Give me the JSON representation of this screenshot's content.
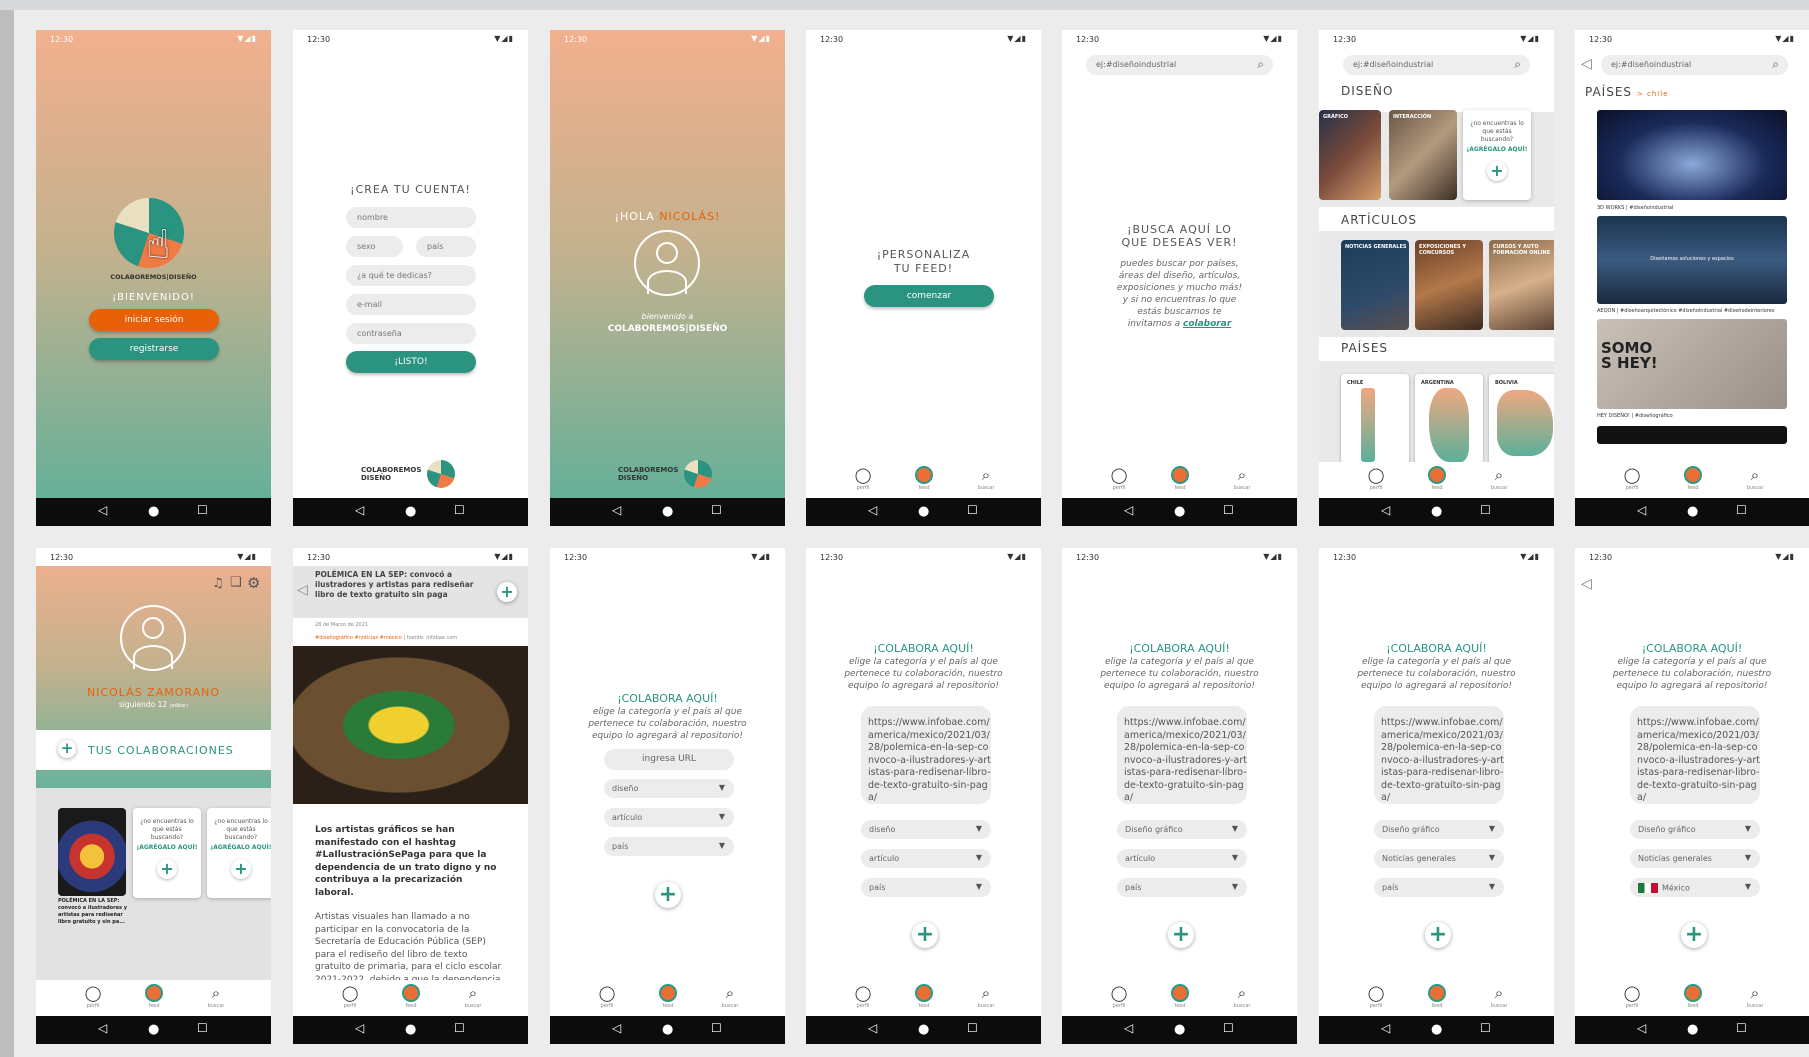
{
  "status": {
    "time": "12:30",
    "icons": "▼◢▮"
  },
  "sysnav": {
    "back": "◁",
    "home": "●",
    "recent": "☐"
  },
  "appnav": {
    "perfil": "perfil",
    "feed": "feed",
    "buscar": "buscar"
  },
  "s1": {
    "logo_text": "COLABOREMOS|DISEÑO",
    "welcome": "¡BIENVENIDO!",
    "login": "iniciar sesión",
    "register": "registrarse"
  },
  "s2": {
    "title": "¡CREA TU CUENTA!",
    "nombre": "nombre",
    "sexo": "sexo",
    "pais": "país",
    "dedicas": "¿a qué te dedicas?",
    "email": "e-mail",
    "password": "contraseña",
    "submit": "¡LISTO!",
    "logo_text": "COLABOREMOS DISEÑO"
  },
  "s3": {
    "hola": "¡HOLA ",
    "name": "NICOLÁS!",
    "bienvenido": "bienvenido a",
    "brand": "COLABOREMOS|DISEÑO",
    "logo_text": "COLABOREMOS DISEÑO"
  },
  "s4": {
    "title1": "¡PERSONALIZA",
    "title2": "TU FEED!",
    "start": "comenzar"
  },
  "s5": {
    "search_placeholder": "ej:#diseñoindustrial",
    "title1": "¡BUSCA AQUÍ LO",
    "title2": "QUE DESEAS VER!",
    "desc1": "puedes buscar por países,",
    "desc2": "áreas del diseño, artículos,",
    "desc3": "exposiciones y mucho más!",
    "desc4": "y si no encuentras lo que",
    "desc5": "estás buscamos te",
    "desc6": "invitamos a ",
    "link": "colaborar"
  },
  "s6": {
    "search_placeholder": "ej:#diseñoindustrial",
    "sec_diseno": "DISEÑO",
    "tile_grafico": "GRÁFICO",
    "tile_interaccion": "INTERACCIÓN",
    "card_q": "¿no encuentras lo que estás buscando?",
    "card_a": "¡AGRÉGALO AQUÍ!",
    "sec_articulos": "ARTÍCULOS",
    "art1": "NOTICIAS GENERALES",
    "art2": "EXPOSICIONES Y CONCURSOS",
    "art3": "CURSOS Y AUTO FORMACIÓN ONLINE",
    "sec_paises": "PAÍSES",
    "pais1": "CHILE",
    "pais2": "ARGENTINA",
    "pais3": "BOLIVIA"
  },
  "s7": {
    "search_placeholder": "ej:#diseñoindustrial",
    "sec": "PAÍSES",
    "crumb": "> chile",
    "cap1": "3D WORKS | #diseñoindustrial",
    "overlay2": "Diseñamos soluciones y espacios",
    "cap2": "AEQON | #diseñoarquitectónico #diseñoindustrial #diseñodeinteriores",
    "img3": "SOMO S HEY!",
    "cap3": "HEY DISEÑO! | #diseñográfico"
  },
  "s8": {
    "name": "NICOLÁS ZAMORANO",
    "following": "siguiendo 12",
    "edit": "(editar)",
    "tus": "TUS COLABORACIONES",
    "post_caption": "POLÉMICA EN LA SEP: convocó a ilustradores y artistas para rediseñar libro gratuito y sin pa...",
    "card_q": "¿no encuentras lo que estás buscando?",
    "card_a": "¡AGRÉGALO AQUÍ!"
  },
  "s9": {
    "title": "POLÉMICA EN LA SEP: convocó a ilustradores y artistas para rediseñar libro de texto gratuito sin paga",
    "date": "28 de Marzo de 2021",
    "tags": "#diseñográfico #noticias #méxico",
    "source": " | fuente: infobae.com",
    "lead": "Los artistas gráficos se han manifestado con el hashtag #LaIlustraciónSePaga para que la dependencia de un trato digno y no contribuya a la precarización laboral.",
    "body": "Artistas visuales han llamado a no participar en la convocatoria de la Secretaría de Educación Pública (SEP) para el rediseño del libro de texto gratuito de primaria, para el ciclo escolar 2021-2022, debido a que la dependencia"
  },
  "s10": {
    "title": "¡COLABORA AQUÍ!",
    "d1": "elige la categoría y el país al que",
    "d2": "pertenece tu colaboración, nuestro",
    "d3": "equipo lo agregará al repositorio!",
    "url": "ingresa URL",
    "cat": "diseño",
    "sub": "artículo",
    "pais": "país"
  },
  "colab": {
    "title": "¡COLABORA AQUÍ!",
    "d1": "elige la categoría y el país al que",
    "d2": "pertenece tu colaboración, nuestro",
    "d3": "equipo lo agregará al repositorio!",
    "url": "https://www.infobae.com/america/mexico/2021/03/28/polemica-en-la-sep-convoco-a-ilustradores-y-artistas-para-redisenar-libro-de-texto-gratuito-sin-paga/"
  },
  "s11": {
    "cat": "diseño",
    "sub": "artículo",
    "pais": "país"
  },
  "s12": {
    "cat": "Diseño gráfico",
    "sub": "artículo",
    "pais": "país"
  },
  "s13": {
    "cat": "Diseño gráfico",
    "sub": "Noticias generales",
    "pais": "país"
  },
  "s14": {
    "cat": "Diseño gráfico",
    "sub": "Noticias generales",
    "pais": "México"
  },
  "colors": {
    "accent_teal": "#2a9480",
    "accent_orange": "#e86109"
  }
}
